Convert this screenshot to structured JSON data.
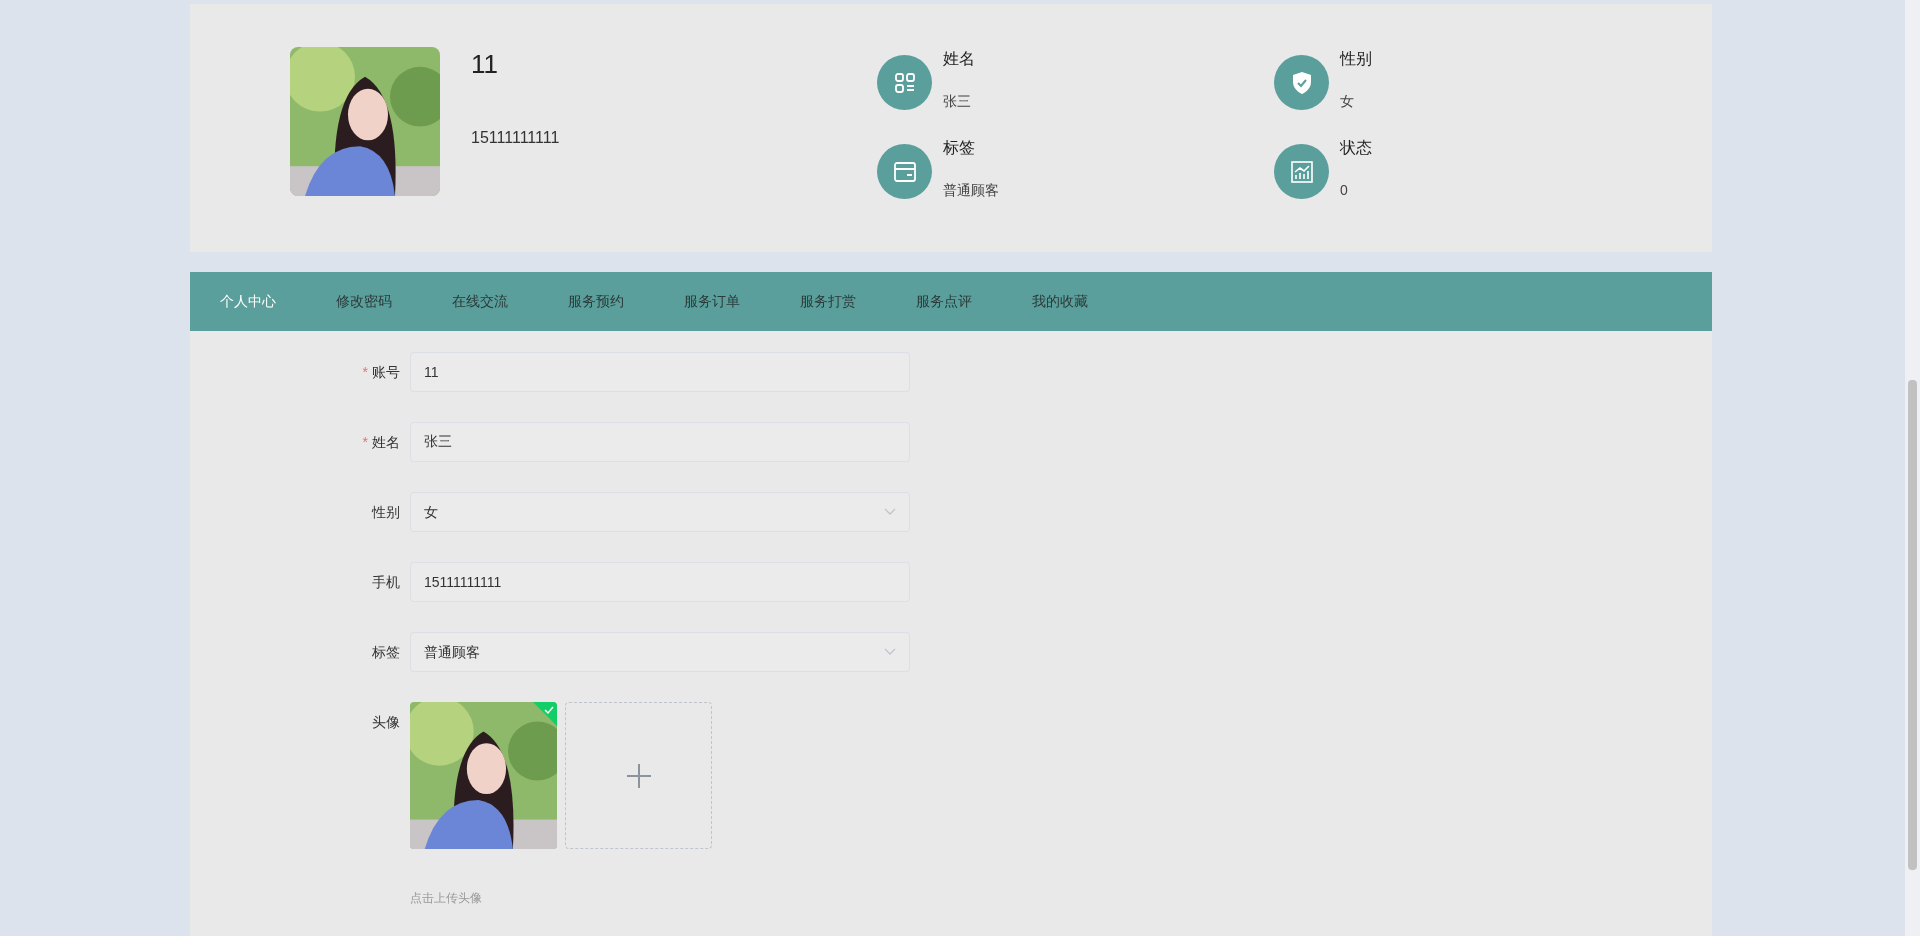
{
  "profile": {
    "account": "11",
    "phone": "15111111111",
    "info": [
      {
        "label": "姓名",
        "value": "张三"
      },
      {
        "label": "性别",
        "value": "女"
      },
      {
        "label": "标签",
        "value": "普通顾客"
      },
      {
        "label": "状态",
        "value": "0"
      }
    ]
  },
  "tabs": [
    {
      "label": "个人中心",
      "selected": true
    },
    {
      "label": "修改密码",
      "selected": false
    },
    {
      "label": "在线交流",
      "selected": false
    },
    {
      "label": "服务预约",
      "selected": false
    },
    {
      "label": "服务订单",
      "selected": false
    },
    {
      "label": "服务打赏",
      "selected": false
    },
    {
      "label": "服务点评",
      "selected": false
    },
    {
      "label": "我的收藏",
      "selected": false
    }
  ],
  "form": {
    "fields": [
      {
        "kind": "input",
        "label": "账号",
        "required_mark": "*",
        "value": "11"
      },
      {
        "kind": "input",
        "label": "姓名",
        "required_mark": "*",
        "value": "张三"
      },
      {
        "kind": "select",
        "label": "性别",
        "value": "女"
      },
      {
        "kind": "input",
        "label": "手机",
        "value": "15111111111"
      },
      {
        "kind": "select",
        "label": "标签",
        "value": "普通顾客"
      }
    ],
    "avatar": {
      "label": "头像",
      "uploaded": true,
      "hint": "点击上传头像"
    }
  }
}
